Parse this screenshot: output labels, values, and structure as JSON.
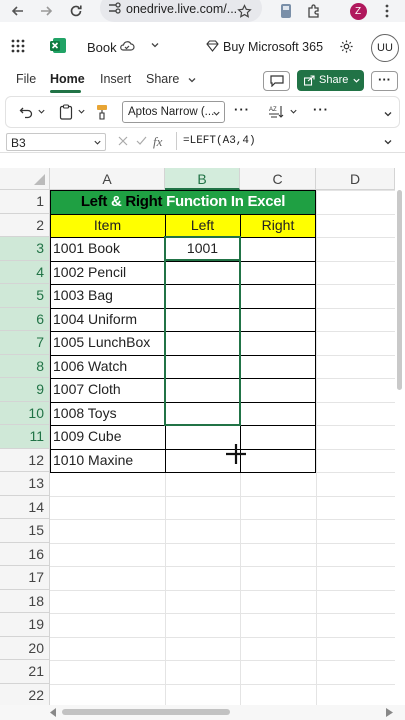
{
  "browser": {
    "url": "onedrive.live.com/...",
    "profile_initial": "Z"
  },
  "app": {
    "name_icon": "excel-icon",
    "doc_title": "Book",
    "buy_label": "Buy Microsoft 365",
    "avatar_initials": "UU"
  },
  "ribbon": {
    "tabs": [
      "File",
      "Home",
      "Insert",
      "Share"
    ],
    "active_tab": "Home",
    "comment_icon": "comment-icon",
    "share_label": "Share"
  },
  "toolbar": {
    "font_name": "Aptos Narrow (...",
    "more": "···"
  },
  "formula_bar": {
    "name_box": "B3",
    "fx": "fx",
    "formula": "=LEFT(A3,4)"
  },
  "sheet": {
    "columns": [
      "A",
      "B",
      "C",
      "D"
    ],
    "rows": [
      "1",
      "2",
      "3",
      "4",
      "5",
      "6",
      "7",
      "8",
      "9",
      "10",
      "11",
      "12",
      "13",
      "14",
      "15",
      "16",
      "17",
      "18",
      "19",
      "20",
      "21",
      "22"
    ],
    "title_parts": [
      "Left ",
      "& ",
      "Right ",
      "Function In Excel"
    ],
    "headers": {
      "item": "Item",
      "left": "Left",
      "right": "Right"
    },
    "items": [
      "1001 Book",
      "1002 Pencil",
      "1003 Bag",
      "1004 Uniform",
      "1005 LunchBox",
      "1006 Watch",
      "1007 Cloth",
      "1008 Toys",
      "1009 Cube",
      "1010 Maxine"
    ],
    "left_values": [
      "1001"
    ],
    "colors": {
      "title_bg": "#1fa043",
      "header_bg": "#ffff00",
      "selection": "#217346"
    }
  }
}
